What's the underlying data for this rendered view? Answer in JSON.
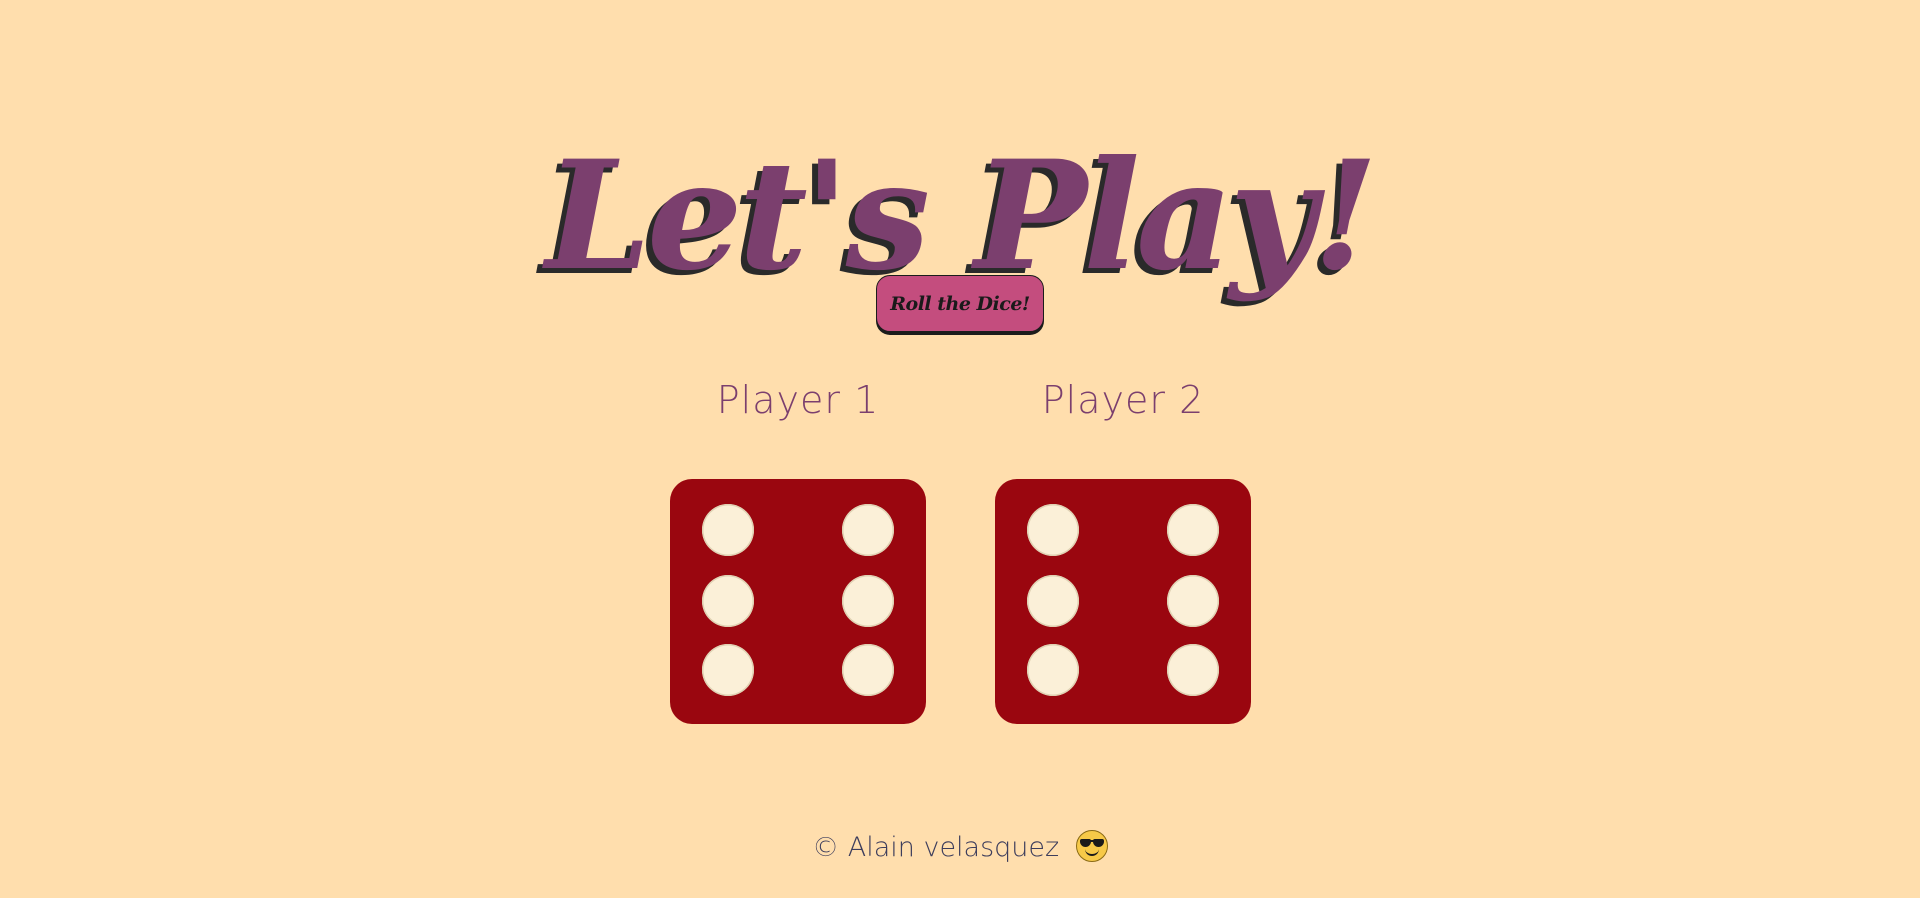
{
  "title": "Let's Play!",
  "roll_button": {
    "label": "Roll the Dice!"
  },
  "players": [
    {
      "label": "Player 1",
      "die_value": 6
    },
    {
      "label": "Player 2",
      "die_value": 6
    }
  ],
  "footer": {
    "text": "© Alain velasquez"
  },
  "icons": {
    "footer_emoji": "sunglasses-face-icon"
  },
  "colors": {
    "background": "#FFDEAD",
    "title": "#7B3F6E",
    "button": "#C44D7E",
    "die": "#9A060F",
    "pip": "#FBF0D8"
  }
}
